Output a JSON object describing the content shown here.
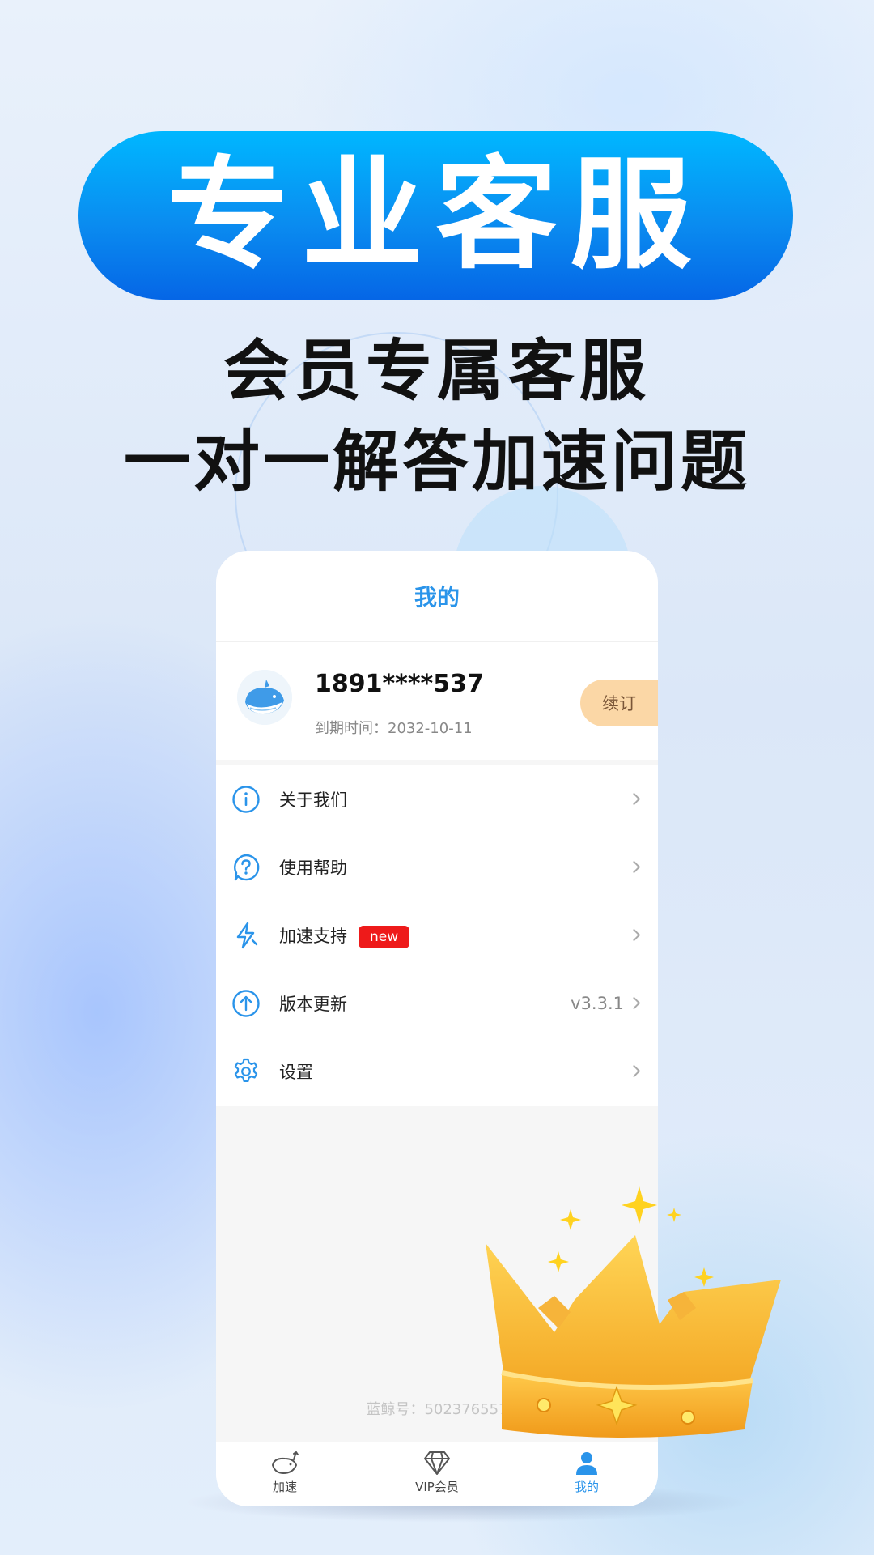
{
  "hero": {
    "title": "专业客服",
    "line1": "会员专属客服",
    "line2": "一对一解答加速问题"
  },
  "app": {
    "header_title": "我的",
    "profile": {
      "phone": "1891****537",
      "expire": "到期时间：2032-10-11",
      "renew_label": "续订"
    },
    "menu": [
      {
        "label": "关于我们",
        "icon": "info-icon"
      },
      {
        "label": "使用帮助",
        "icon": "help-icon"
      },
      {
        "label": "加速支持",
        "icon": "lightning-icon",
        "badge": "new"
      },
      {
        "label": "版本更新",
        "icon": "upload-icon",
        "value": "v3.3.1"
      },
      {
        "label": "设置",
        "icon": "gear-icon"
      }
    ],
    "footer_id": "蓝鲸号：502376557",
    "tabs": [
      {
        "label": "加速",
        "icon": "whale-icon"
      },
      {
        "label": "VIP会员",
        "icon": "diamond-icon"
      },
      {
        "label": "我的",
        "icon": "user-icon",
        "active": true
      }
    ],
    "colors": {
      "accent": "#2a94ea",
      "badge": "#ee1a1a",
      "renew_bg": "#fbd7a6"
    }
  }
}
